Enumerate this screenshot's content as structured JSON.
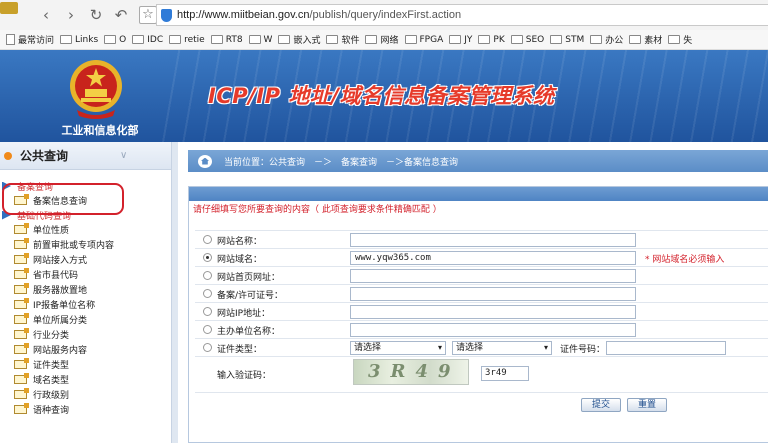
{
  "browser": {
    "url_prefix": "http://www.",
    "url_domain": "miitbeian.gov.cn",
    "url_path": "/publish/query/indexFirst.action",
    "bookmarks": [
      {
        "label": "最常访问",
        "kind": "page"
      },
      {
        "label": "Links",
        "kind": "folder"
      },
      {
        "label": "O",
        "kind": "folder"
      },
      {
        "label": "IDC",
        "kind": "folder"
      },
      {
        "label": "retie",
        "kind": "folder"
      },
      {
        "label": "RT8",
        "kind": "folder"
      },
      {
        "label": "W",
        "kind": "folder"
      },
      {
        "label": "嵌入式",
        "kind": "folder"
      },
      {
        "label": "软件",
        "kind": "folder"
      },
      {
        "label": "网络",
        "kind": "folder"
      },
      {
        "label": "FPGA",
        "kind": "folder"
      },
      {
        "label": "JY",
        "kind": "folder"
      },
      {
        "label": "PK",
        "kind": "folder"
      },
      {
        "label": "SEO",
        "kind": "folder"
      },
      {
        "label": "STM",
        "kind": "folder"
      },
      {
        "label": "办公",
        "kind": "folder"
      },
      {
        "label": "素材",
        "kind": "folder"
      },
      {
        "label": "失",
        "kind": "folder"
      }
    ]
  },
  "header": {
    "ministry": "工业和信息化部",
    "system_title": "ICP/IP 地址/域名信息备案管理系统"
  },
  "sidebar": {
    "title": "公共查询",
    "groups": [
      {
        "label": "备案查询",
        "items": [
          "备案信息查询"
        ]
      },
      {
        "label": "基础代码查询",
        "items": [
          "单位性质",
          "前置审批或专项内容",
          "网站接入方式",
          "省市县代码",
          "服务器放置地",
          "IP报备单位名称",
          "单位所属分类",
          "行业分类",
          "网站服务内容",
          "证件类型",
          "域名类型",
          "行政级别",
          "语种查询"
        ]
      }
    ]
  },
  "main": {
    "breadcrumb": "当前位置：公共查询　－＞　备案查询　－＞备案信息查询",
    "notice": "请仔细填写您所要查询的内容（ 此项查询要求条件精确匹配 ）",
    "fields": [
      {
        "label": "网站名称：",
        "value": "",
        "selected": false
      },
      {
        "label": "网站域名：",
        "value": "www.yqw365.com",
        "selected": true
      },
      {
        "label": "网站首页网址：",
        "value": "",
        "selected": false
      },
      {
        "label": "备案/许可证号：",
        "value": "",
        "selected": false
      },
      {
        "label": "网站IP地址：",
        "value": "",
        "selected": false
      },
      {
        "label": "主办单位名称：",
        "value": "",
        "selected": false
      }
    ],
    "required_note": "* 网站域名必须输入",
    "cert": {
      "label": "证件类型：",
      "select1": "请选择",
      "select2": "请选择",
      "number_label": "证件号码："
    },
    "captcha": {
      "label": "输入验证码：",
      "image_text": "3R49",
      "input_value": "3r49"
    },
    "buttons": {
      "submit": "提交",
      "reset": "重置"
    }
  }
}
